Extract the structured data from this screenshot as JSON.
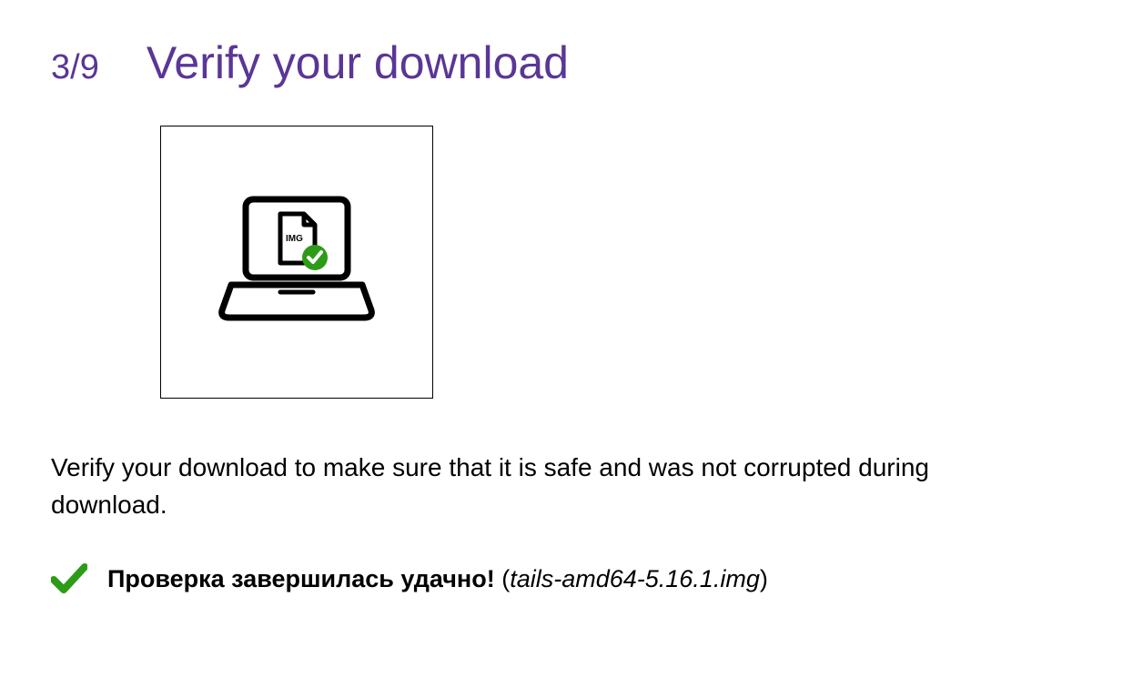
{
  "step": {
    "counter": "3/9",
    "title": "Verify your download"
  },
  "illustration": {
    "img_label": "IMG"
  },
  "description": "Verify your download to make sure that it is safe and was not corrupted during download.",
  "status": {
    "success_label": "Проверка завершилась удачно!",
    "filename": "tails-amd64-5.16.1.img"
  },
  "colors": {
    "accent": "#5a3696",
    "success": "#2e9b17"
  }
}
